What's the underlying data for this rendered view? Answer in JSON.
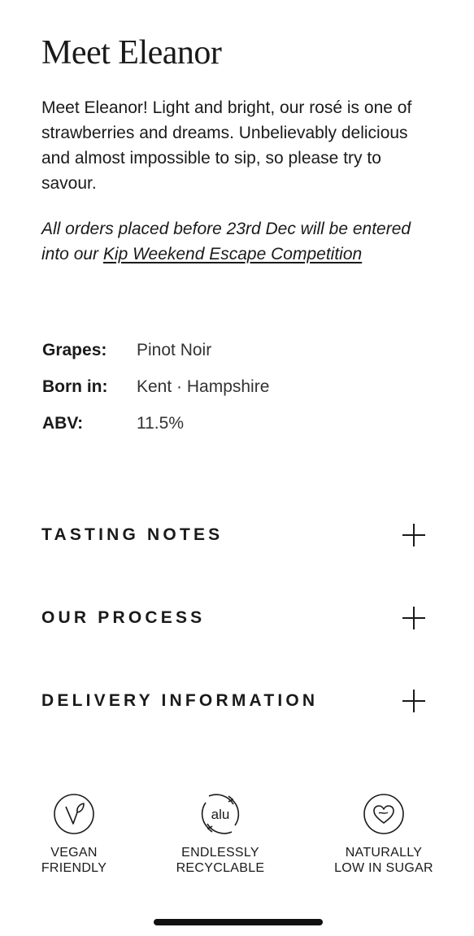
{
  "product": {
    "title": "Meet Eleanor",
    "description": "Meet Eleanor! Light and bright, our rosé is one of strawberries and dreams. Unbelievably delicious and almost impossible to sip, so please try to savour.",
    "promo_prefix": "All orders placed before 23rd Dec will be entered into our ",
    "promo_link": "Kip Weekend Escape Competition"
  },
  "specs": [
    {
      "label": "Grapes:",
      "value": "Pinot Noir"
    },
    {
      "label": "Born in:",
      "value": "Kent · Hampshire"
    },
    {
      "label": "ABV:",
      "value": "11.5%"
    }
  ],
  "accordions": [
    {
      "title": "TASTING NOTES"
    },
    {
      "title": "OUR PROCESS"
    },
    {
      "title": "DELIVERY INFORMATION"
    }
  ],
  "badges": [
    {
      "icon": "vegan-leaf-icon",
      "line1": "VEGAN",
      "line2": "FRIENDLY"
    },
    {
      "icon": "alu-recycle-icon",
      "icon_text": "alu",
      "line1": "ENDLESSLY",
      "line2": "RECYCLABLE"
    },
    {
      "icon": "heart-icon",
      "line1": "NATURALLY",
      "line2": "LOW IN SUGAR"
    }
  ]
}
